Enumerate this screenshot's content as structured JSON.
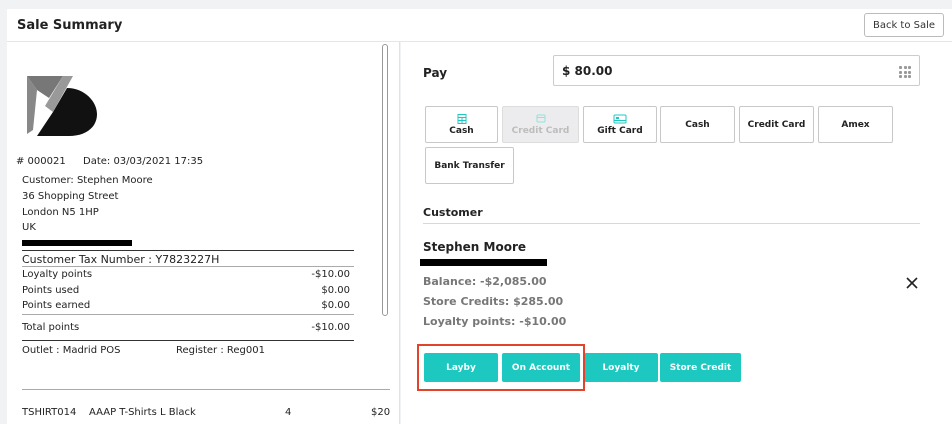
{
  "header": {
    "title": "Sale Summary",
    "back_label": "Back to Sale"
  },
  "receipt": {
    "sale_no": "# 000021",
    "date": "Date: 03/03/2021 17:35",
    "customer": "Customer: Stephen Moore",
    "address1": "36 Shopping Street",
    "address2": "London N5 1HP",
    "country": "UK",
    "tax_number": "Customer Tax Number : Y7823227H",
    "loyalty_points_label": "Loyalty points",
    "loyalty_points_value": "-$10.00",
    "points_used_label": "Points used",
    "points_used_value": "$0.00",
    "points_earned_label": "Points earned",
    "points_earned_value": "$0.00",
    "total_points_label": "Total points",
    "total_points_value": "-$10.00",
    "outlet": "Outlet : Madrid POS",
    "register": "Register : Reg001",
    "line_sku": "TSHIRT014",
    "line_desc": "AAAP T-Shirts L Black",
    "line_qty": "4",
    "line_amount": "$20"
  },
  "pay": {
    "label": "Pay",
    "amount": "$ 80.00",
    "methods_row1": [
      {
        "label": "Cash",
        "icon": "cash-register-icon"
      },
      {
        "label": "Credit Card",
        "icon": "credit-card-icon",
        "disabled": true
      },
      {
        "label": "Gift Card",
        "icon": "gift-card-icon"
      },
      {
        "label": "Cash"
      },
      {
        "label": "Credit Card"
      },
      {
        "label": "Amex"
      }
    ],
    "methods_row2": [
      {
        "label": "Bank Transfer"
      }
    ]
  },
  "customer": {
    "section_title": "Customer",
    "name": "Stephen Moore",
    "balance": "Balance: -$2,085.00",
    "store_credits": "Store Credits: $285.00",
    "loyalty_points": "Loyalty points: -$10.00"
  },
  "actions": [
    "Layby",
    "On Account",
    "Loyalty",
    "Store Credit"
  ],
  "colors": {
    "accent": "#1cc8c0",
    "highlight": "#e0442a"
  }
}
